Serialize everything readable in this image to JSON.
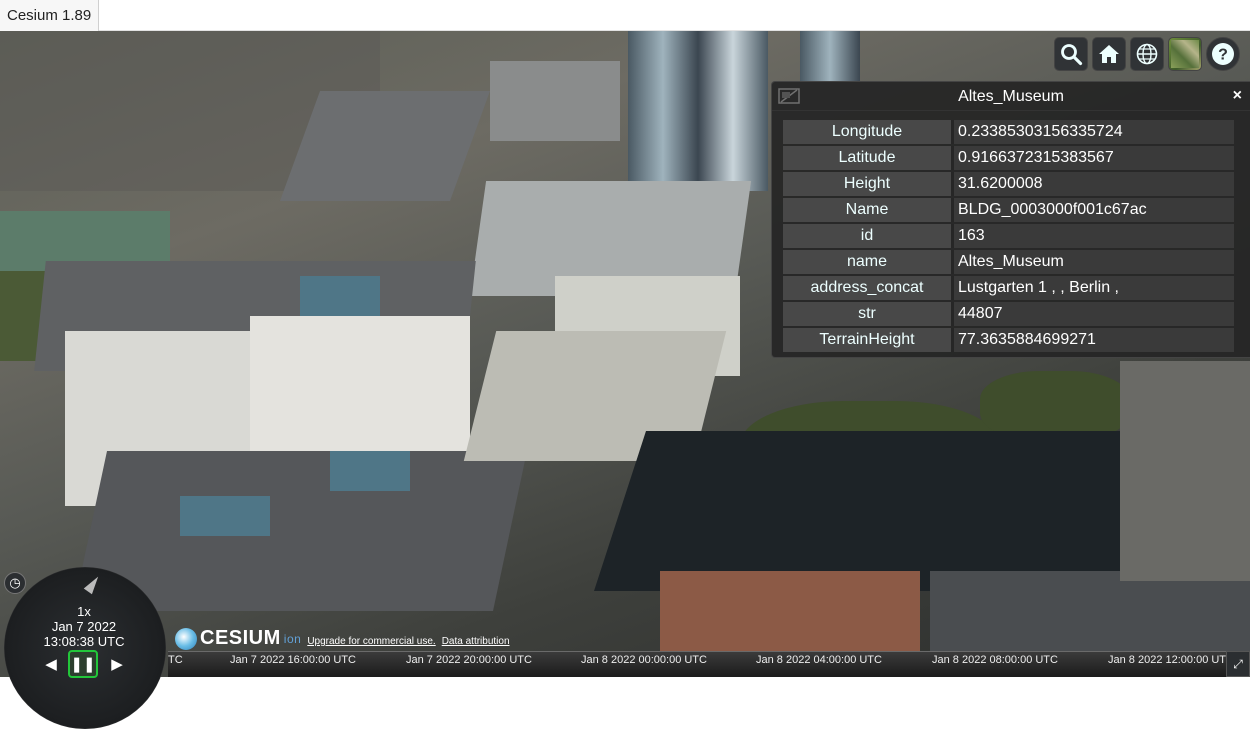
{
  "tab": {
    "title": "Cesium 1.89"
  },
  "toolbar": {
    "buttons": [
      {
        "name": "geocoder",
        "icon": "search-icon"
      },
      {
        "name": "home",
        "icon": "home-icon"
      },
      {
        "name": "scene-mode",
        "icon": "globe-icon"
      },
      {
        "name": "base-layer-picker",
        "icon": "imagery-thumbnail-icon"
      },
      {
        "name": "navigation-help",
        "icon": "question-icon"
      }
    ]
  },
  "infobox": {
    "title": "Altes_Museum",
    "close": "×",
    "rows": [
      {
        "key": "Longitude",
        "value": "0.23385303156335724"
      },
      {
        "key": "Latitude",
        "value": "0.9166372315383567"
      },
      {
        "key": "Height",
        "value": "31.6200008"
      },
      {
        "key": "Name",
        "value": "BLDG_0003000f001c67ac"
      },
      {
        "key": "id",
        "value": "163"
      },
      {
        "key": "name",
        "value": "Altes_Museum"
      },
      {
        "key": "address_concat",
        "value": "Lustgarten 1 , , Berlin ,"
      },
      {
        "key": "str",
        "value": "44807"
      },
      {
        "key": "TerrainHeight",
        "value": "77.3635884699271"
      }
    ]
  },
  "animation": {
    "speed": "1x",
    "date": "Jan 7 2022",
    "time": "13:08:38 UTC"
  },
  "credits": {
    "logo_text": "CESIUM",
    "logo_suffix": "ion",
    "upgrade": "Upgrade for commercial use.",
    "attribution": "Data attribution"
  },
  "timeline": {
    "ticks": [
      "TC",
      "Jan 7 2022 16:00:00 UTC",
      "Jan 7 2022 20:00:00 UTC",
      "Jan 8 2022 00:00:00 UTC",
      "Jan 8 2022 04:00:00 UTC",
      "Jan 8 2022 08:00:00 UTC",
      "Jan 8 2022 12:00:00 UTC"
    ]
  },
  "colors": {
    "pause_active": "#22c73a",
    "ion_blue": "#62a1d7",
    "panel_bg": "#262626"
  }
}
